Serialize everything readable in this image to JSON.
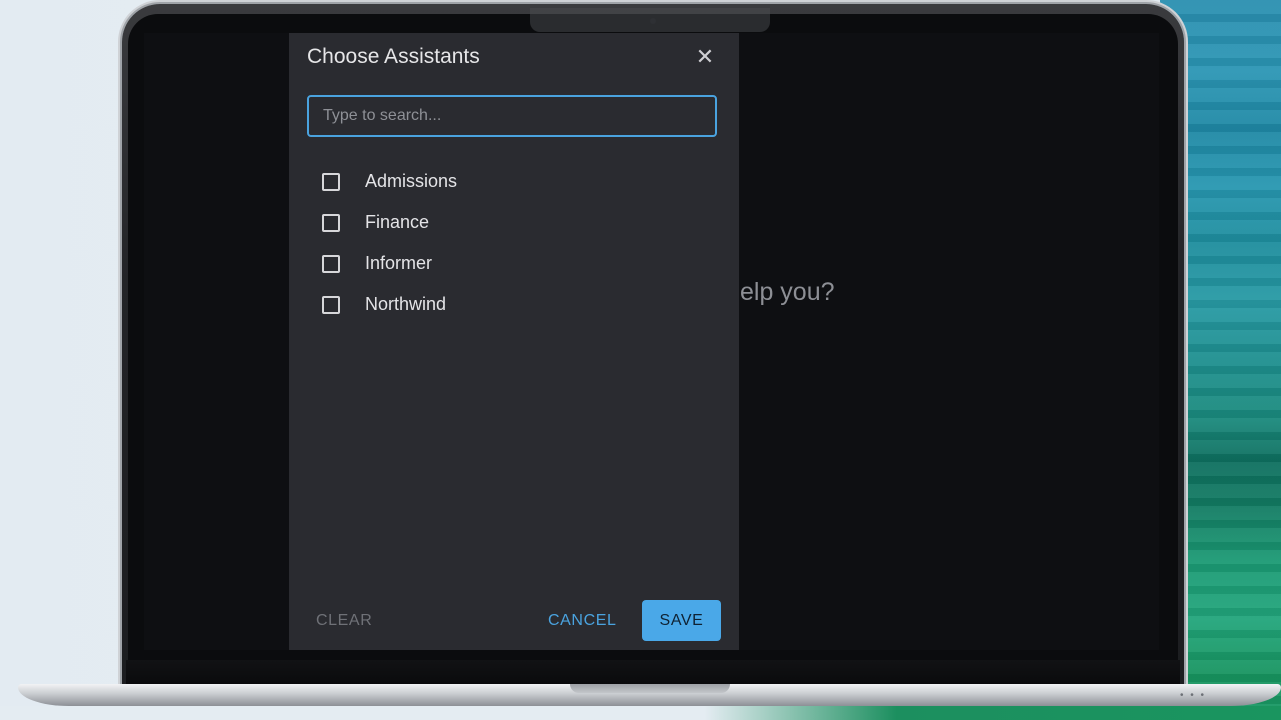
{
  "dialog": {
    "title": "Choose Assistants",
    "close_icon": "close-icon",
    "search": {
      "value": "",
      "placeholder": "Type to search..."
    },
    "items": [
      {
        "label": "Admissions",
        "checked": false
      },
      {
        "label": "Finance",
        "checked": false
      },
      {
        "label": "Informer",
        "checked": false
      },
      {
        "label": "Northwind",
        "checked": false
      }
    ],
    "buttons": {
      "clear": "CLEAR",
      "cancel": "CANCEL",
      "save": "SAVE"
    }
  },
  "background": {
    "prompt_fragment": "elp you?"
  },
  "colors": {
    "accent": "#4aa3df",
    "save_button": "#4aa8e8",
    "dialog_bg": "#2a2b30",
    "screen_bg": "#0e0f12"
  }
}
